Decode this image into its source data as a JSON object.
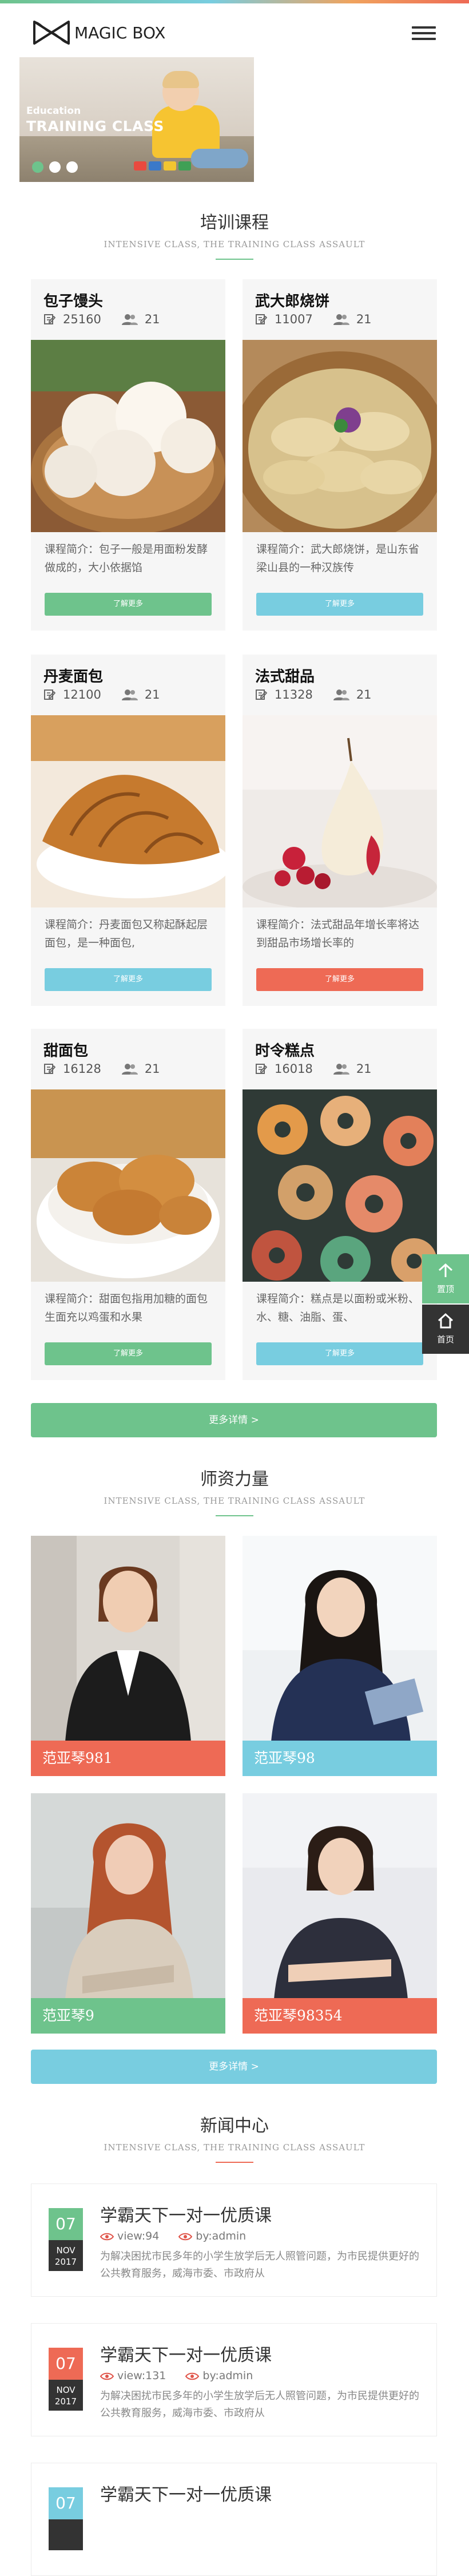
{
  "brand": {
    "name": "MAGIC BOX"
  },
  "banner": {
    "caption_small": "Education",
    "caption_big": "TRAINING CLASS"
  },
  "courses": {
    "title": "培训课程",
    "subtitle": "INTENSIVE CLASS, THE TRAINING CLASS ASSAULT",
    "more_label": "更多详情  >",
    "items": [
      {
        "name": "包子馒头",
        "views": "25160",
        "likes": "21",
        "desc": "课程简介：包子一般是用面粉发酵做成的，大小依据馅",
        "button": "了解更多",
        "button_color": "#6ec38c"
      },
      {
        "name": "武大郎烧饼",
        "views": "11007",
        "likes": "21",
        "desc": "课程简介：武大郎烧饼，是山东省梁山县的一种汉族传",
        "button": "了解更多",
        "button_color": "#78cde0"
      },
      {
        "name": "丹麦面包",
        "views": "12100",
        "likes": "21",
        "desc": "课程简介：丹麦面包又称起酥起层面包，是一种面包,",
        "button": "了解更多",
        "button_color": "#78cde0"
      },
      {
        "name": "法式甜品",
        "views": "11328",
        "likes": "21",
        "desc": "课程简介：法式甜品年增长率将达到甜品市场增长率的",
        "button": "了解更多",
        "button_color": "#ee6a55"
      },
      {
        "name": "甜面包",
        "views": "16128",
        "likes": "21",
        "desc": "课程简介：甜面包指用加糖的面包生面充以鸡蛋和水果",
        "button": "了解更多",
        "button_color": "#6ec38c"
      },
      {
        "name": "时令糕点",
        "views": "16018",
        "likes": "21",
        "desc": "课程简介：糕点是以面粉或米粉、水、糖、油脂、蛋、",
        "button": "了解更多",
        "button_color": "#78cde0"
      }
    ]
  },
  "teachers": {
    "title": "师资力量",
    "subtitle": "INTENSIVE CLASS, THE TRAINING CLASS ASSAULT",
    "more_label": "更多详情  >",
    "items": [
      {
        "name": "范亚琴981",
        "color": "#ee6a55"
      },
      {
        "name": "范亚琴98",
        "color": "#78cde0"
      },
      {
        "name": "范亚琴9",
        "color": "#6ec38c"
      },
      {
        "name": "范亚琴98354",
        "color": "#ee6a55"
      }
    ]
  },
  "news": {
    "title": "新闻中心",
    "subtitle": "INTENSIVE CLASS, THE TRAINING CLASS ASSAULT",
    "items": [
      {
        "day": "07",
        "month": "NOV",
        "year": "2017",
        "title": "学霸天下一对一优质课",
        "views": "view:94",
        "author": "by:admin",
        "desc": "为解决困扰市民多年的小学生放学后无人照管问题，为市民提供更好的公共教育服务，威海市委、市政府从",
        "color": "#6ec38c"
      },
      {
        "day": "07",
        "month": "NOV",
        "year": "2017",
        "title": "学霸天下一对一优质课",
        "views": "view:131",
        "author": "by:admin",
        "desc": "为解决困扰市民多年的小学生放学后无人照管问题，为市民提供更好的公共教育服务，威海市委、市政府从",
        "color": "#ee6a55"
      },
      {
        "day": "07",
        "month": "",
        "year": "",
        "title": "学霸天下一对一优质课",
        "views": "",
        "author": "",
        "desc": "",
        "color": "#78cde0"
      }
    ]
  },
  "float": {
    "top_label": "置顶",
    "home_label": "首页"
  }
}
